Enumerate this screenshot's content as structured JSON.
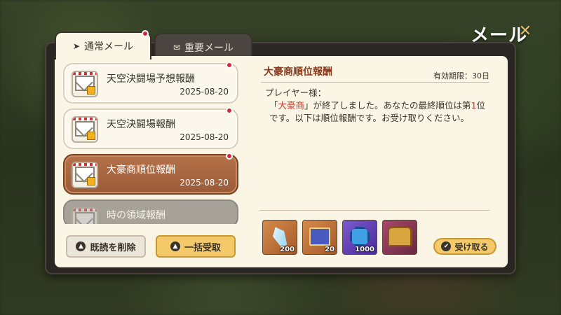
{
  "window": {
    "title": "メール",
    "close_symbol": "✕"
  },
  "tabs": [
    {
      "label": "通常メール",
      "icon": "paper-plane-icon",
      "active": true,
      "has_badge": true
    },
    {
      "label": "重要メール",
      "icon": "envelope-icon",
      "active": false,
      "has_badge": false
    }
  ],
  "mails": [
    {
      "title": "天空決闘場予想報酬",
      "date": "2025-08-20",
      "unread": true
    },
    {
      "title": "天空決闘場報酬",
      "date": "2025-08-20",
      "unread": true
    },
    {
      "title": "大豪商順位報酬",
      "date": "2025-08-20",
      "unread": true,
      "selected": true
    },
    {
      "title": "時の領域報酬",
      "date": "",
      "unread": false
    }
  ],
  "buttons": {
    "delete_read": "既読を削除",
    "claim_all": "一括受取",
    "receive": "受け取る"
  },
  "detail": {
    "title": "大豪商順位報酬",
    "expiry": "有効期限：30日",
    "greeting": "プレイヤー様：",
    "body_pre": "「",
    "body_event": "大豪商",
    "body_mid": "」が終了しました。あなたの最終順位は",
    "body_rank_pre": "第",
    "body_rank": "1",
    "body_post": "位です。以下は順位報酬です。お受け取りください。"
  },
  "rewards": [
    {
      "name": "crystal-icon",
      "qty": "200"
    },
    {
      "name": "skill-book-icon",
      "qty": "20"
    },
    {
      "name": "gem-icon",
      "qty": "1000"
    },
    {
      "name": "treasure-chest-icon",
      "qty": ""
    }
  ],
  "colors": {
    "accent": "#f4c96a",
    "selected_mail": "#a8653f",
    "title_red": "#8a3a1a",
    "highlight": "#c8382a",
    "badge": "#d1283a"
  }
}
